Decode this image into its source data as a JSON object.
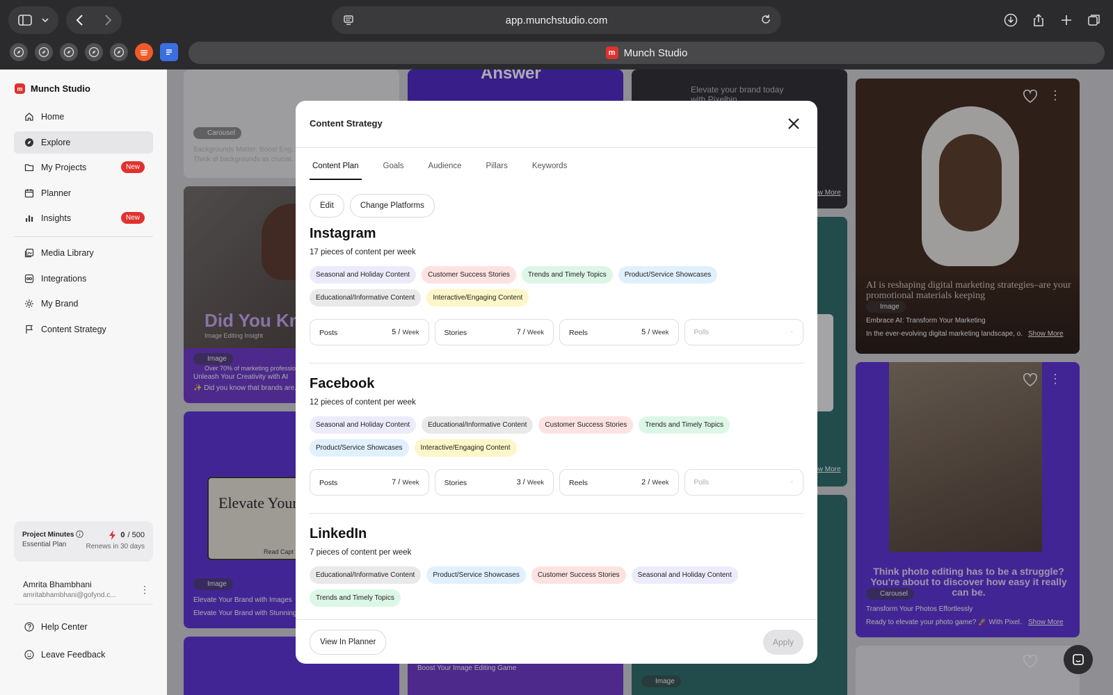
{
  "browser": {
    "url": "app.munchstudio.com",
    "tab_title": "Munch Studio"
  },
  "sidebar": {
    "brand": "Munch Studio",
    "nav": [
      {
        "label": "Home",
        "icon": "home-icon"
      },
      {
        "label": "Explore",
        "icon": "compass-icon",
        "active": true
      },
      {
        "label": "My Projects",
        "icon": "folder-icon",
        "badge": "New"
      },
      {
        "label": "Planner",
        "icon": "calendar-icon"
      },
      {
        "label": "Insights",
        "icon": "bar-chart-icon",
        "badge": "New"
      }
    ],
    "nav2": [
      {
        "label": "Media Library",
        "icon": "media-library-icon"
      },
      {
        "label": "Integrations",
        "icon": "integrations-icon"
      },
      {
        "label": "My Brand",
        "icon": "brand-gear-icon"
      },
      {
        "label": "Content Strategy",
        "icon": "flag-icon"
      }
    ],
    "minutes": {
      "label": "Project Minutes",
      "plan": "Essential Plan",
      "used": "0",
      "total": "/ 500",
      "renews": "Renews in 30 days"
    },
    "user": {
      "name": "Amrita Bhambhani",
      "email": "amritabhambhani@gofynd.c..."
    },
    "bottom": [
      {
        "label": "Help Center",
        "icon": "help-icon"
      },
      {
        "label": "Leave Feedback",
        "icon": "feedback-icon"
      }
    ]
  },
  "background": {
    "card1_type": "Carousel",
    "card1_caption": "Backgrounds Matter: Boost Eng...",
    "card1_caption2": "Think of backgrounds as crucial...",
    "card2_heading": "Did You Kno",
    "card2_sub": "Image Editing Insight",
    "card2_type": "Image",
    "card2_text": "Over 70% of marketing professio...",
    "card2_title": "Unleash Your Creativity with AI",
    "card2_desc": "✨ Did you know that brands are...",
    "card3_heading": "Elevate Your Stunning",
    "card3_btn": "Read Capt",
    "card3_type": "Image",
    "card3_title": "Elevate Your Brand with Images",
    "card3_desc": "Elevate Your Brand with Stunning...",
    "card4_heading": "Answer",
    "card4_bottom": "Boost Your Image Editing Game",
    "card5_text": "Elevate your brand today with Pixelbin",
    "card5_more": "Show More",
    "card6_more": "Show More",
    "card7_type": "Image",
    "card8_quote": "AI is reshaping digital marketing strategies–are your promotional materials keeping",
    "card8_type": "Image",
    "card8_title": "Embrace AI: Transform Your Marketing",
    "card8_desc": "In the ever-evolving digital marketing landscape, o...",
    "card8_more": "Show More",
    "card9_quote": "Think photo editing has to be a struggle? You're about to discover how easy it really can be.",
    "card9_type": "Carousel",
    "card9_title": "Transform Your Photos Effortlessly",
    "card9_desc": "Ready to elevate your photo game? 🚀 With Pixel...",
    "card9_more": "Show More"
  },
  "modal": {
    "title": "Content Strategy",
    "tabs": [
      "Content Plan",
      "Goals",
      "Audience",
      "Pillars",
      "Keywords"
    ],
    "edit_label": "Edit",
    "change_platforms_label": "Change Platforms",
    "platforms": [
      {
        "name": "Instagram",
        "summary": "17 pieces of content per week",
        "tags": [
          {
            "label": "Seasonal and Holiday Content",
            "color": "#ecebfb"
          },
          {
            "label": "Customer Success Stories",
            "color": "#fde2e2"
          },
          {
            "label": "Trends and Timely Topics",
            "color": "#dcf7e5"
          },
          {
            "label": "Product/Service Showcases",
            "color": "#e0f0fd"
          },
          {
            "label": "Educational/Informative Content",
            "color": "#e9e9ea"
          },
          {
            "label": "Interactive/Engaging Content",
            "color": "#fdf6c8"
          }
        ],
        "metrics": [
          {
            "label": "Posts",
            "value": "5",
            "unit": "Week"
          },
          {
            "label": "Stories",
            "value": "7",
            "unit": "Week"
          },
          {
            "label": "Reels",
            "value": "5",
            "unit": "Week"
          },
          {
            "label": "Polls",
            "value": "-",
            "empty": true
          }
        ]
      },
      {
        "name": "Facebook",
        "summary": "12 pieces of content per week",
        "tags": [
          {
            "label": "Seasonal and Holiday Content",
            "color": "#ecebfb"
          },
          {
            "label": "Educational/Informative Content",
            "color": "#e9e9ea"
          },
          {
            "label": "Customer Success Stories",
            "color": "#fde2e2"
          },
          {
            "label": "Trends and Timely Topics",
            "color": "#dcf7e5"
          },
          {
            "label": "Product/Service Showcases",
            "color": "#e0f0fd"
          },
          {
            "label": "Interactive/Engaging Content",
            "color": "#fdf6c8"
          }
        ],
        "metrics": [
          {
            "label": "Posts",
            "value": "7",
            "unit": "Week"
          },
          {
            "label": "Stories",
            "value": "3",
            "unit": "Week"
          },
          {
            "label": "Reels",
            "value": "2",
            "unit": "Week"
          },
          {
            "label": "Polls",
            "value": "-",
            "empty": true
          }
        ]
      },
      {
        "name": "LinkedIn",
        "summary": "7 pieces of content per week",
        "tags": [
          {
            "label": "Educational/Informative Content",
            "color": "#e9e9ea"
          },
          {
            "label": "Product/Service Showcases",
            "color": "#e0f0fd"
          },
          {
            "label": "Customer Success Stories",
            "color": "#fde2e2"
          },
          {
            "label": "Seasonal and Holiday Content",
            "color": "#ecebfb"
          },
          {
            "label": "Trends and Timely Topics",
            "color": "#dcf7e5"
          }
        ],
        "metrics": []
      }
    ],
    "view_planner_label": "View In Planner",
    "apply_label": "Apply"
  },
  "colors": {
    "accent_red": "#e0322d",
    "purple": "#5b2fd6"
  }
}
